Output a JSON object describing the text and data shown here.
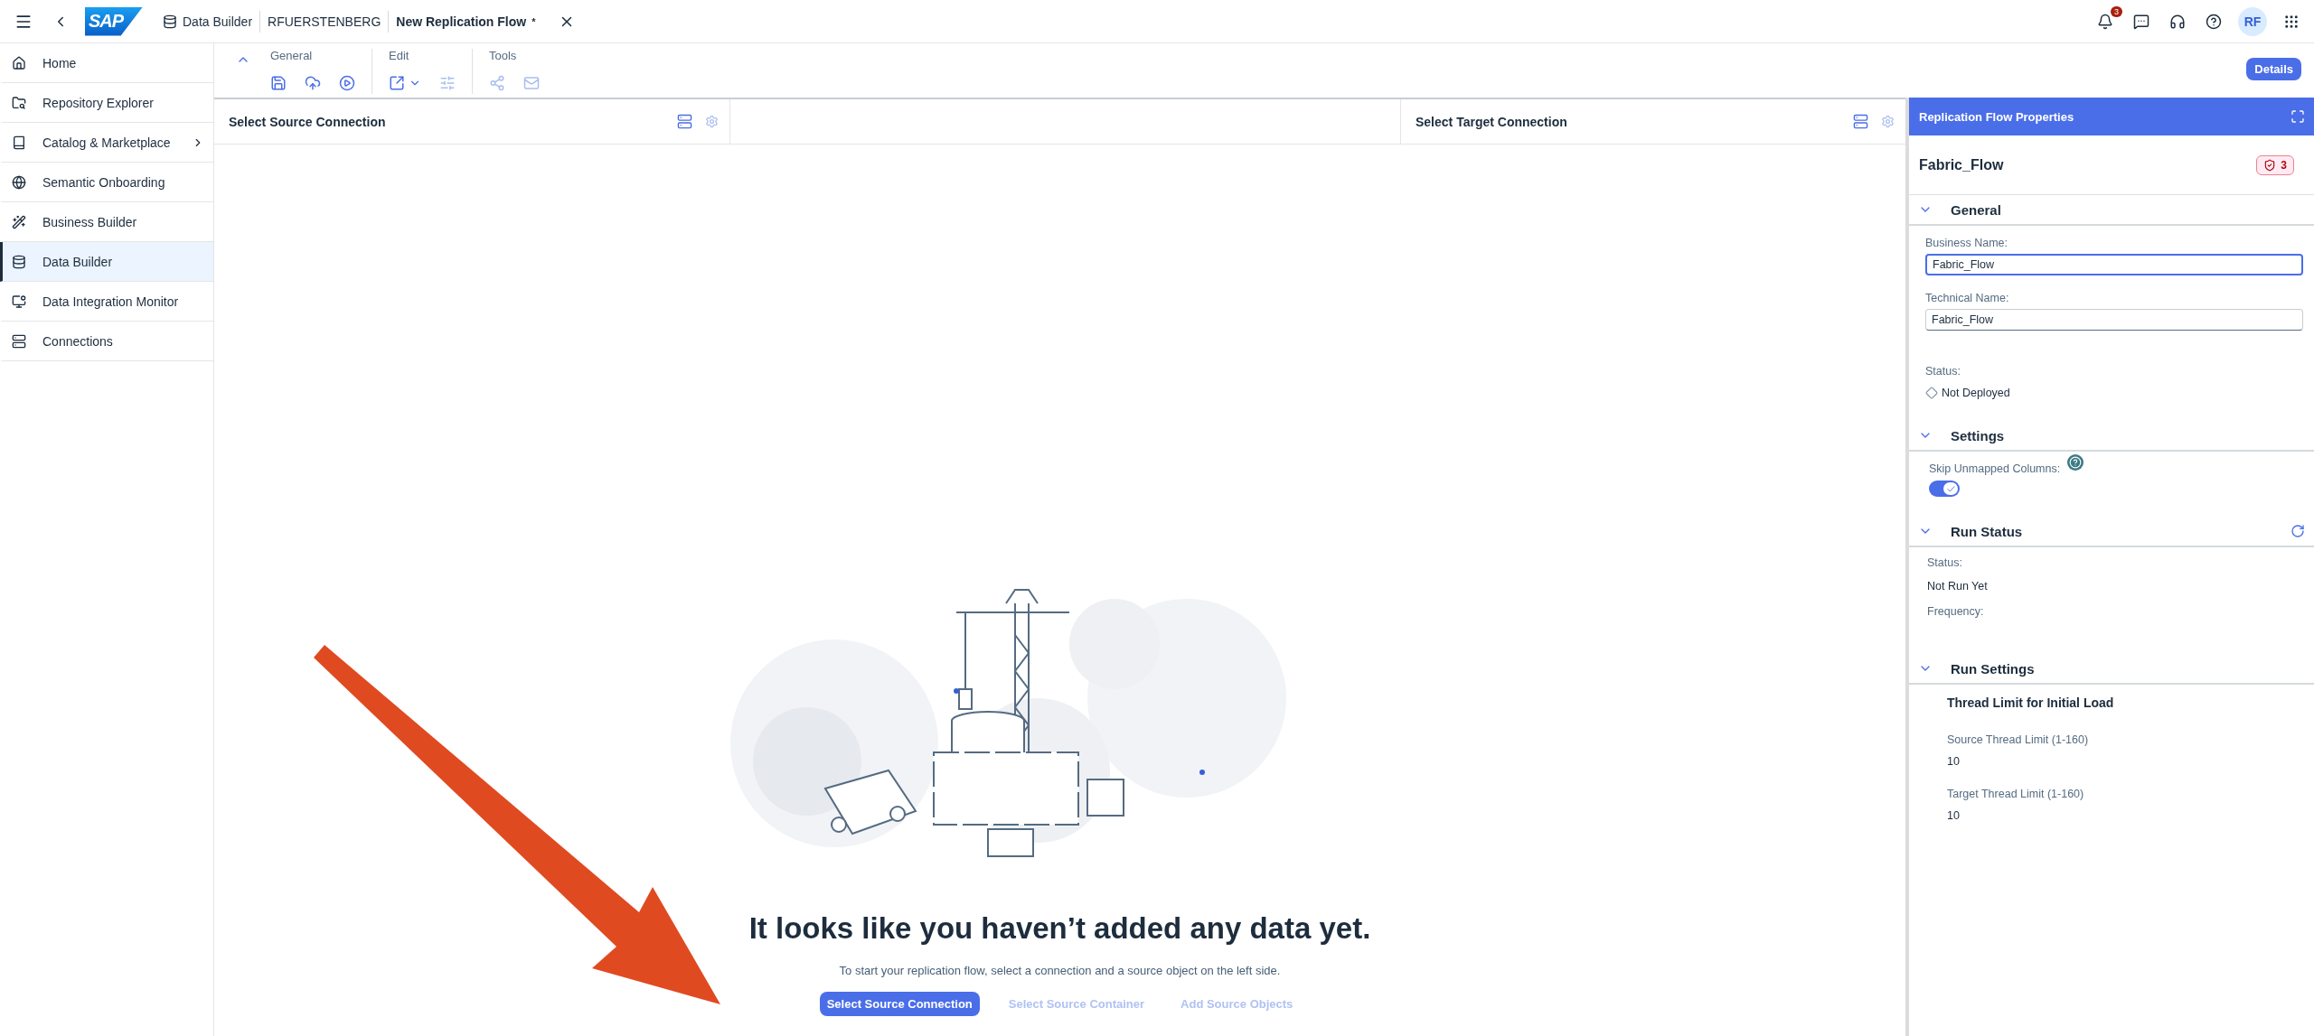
{
  "shellbar": {
    "logo_text": "SAP",
    "breadcrumbs": [
      {
        "label": "Data Builder",
        "current": false
      },
      {
        "label": "RFUERSTENBERG",
        "current": false
      },
      {
        "label": "New Replication Flow",
        "current": true
      }
    ],
    "dirty_mark": "*",
    "notification_count": "3",
    "avatar_initials": "RF"
  },
  "sidebar": {
    "items": [
      {
        "label": "Home",
        "kind": "home",
        "selected": false,
        "expandable": false
      },
      {
        "label": "Repository Explorer",
        "kind": "repository",
        "selected": false,
        "expandable": false
      },
      {
        "label": "Catalog & Marketplace",
        "kind": "catalog",
        "selected": false,
        "expandable": true
      },
      {
        "label": "Semantic Onboarding",
        "kind": "semantic",
        "selected": false,
        "expandable": false
      },
      {
        "label": "Business Builder",
        "kind": "business",
        "selected": false,
        "expandable": false
      },
      {
        "label": "Data Builder",
        "kind": "data",
        "selected": true,
        "expandable": false
      },
      {
        "label": "Data Integration Monitor",
        "kind": "monitor",
        "selected": false,
        "expandable": false
      },
      {
        "label": "Connections",
        "kind": "connections",
        "selected": false,
        "expandable": false
      }
    ]
  },
  "toolbar": {
    "expanded": true,
    "groups": [
      {
        "label": "General",
        "buttons": [
          {
            "kind": "save",
            "disabled": false
          },
          {
            "kind": "deploy",
            "disabled": false
          },
          {
            "kind": "run",
            "disabled": false
          }
        ]
      },
      {
        "label": "Edit",
        "buttons": [
          {
            "kind": "export",
            "disabled": false
          },
          {
            "kind": "mapping",
            "disabled": true
          }
        ]
      },
      {
        "label": "Tools",
        "buttons": [
          {
            "kind": "lineage",
            "disabled": true
          },
          {
            "kind": "mail",
            "disabled": true
          }
        ]
      }
    ],
    "details_button": "Details"
  },
  "canvas": {
    "source_header": "Select Source Connection",
    "target_header": "Select Target Connection",
    "empty_state": {
      "title": "It looks like you haven’t added any data yet.",
      "text": "To start your replication flow, select a connection and a source object on the left side.",
      "steps": [
        {
          "label": "Select Source Connection",
          "enabled": true
        },
        {
          "label": "Select Source Container",
          "enabled": false
        },
        {
          "label": "Add Source Objects",
          "enabled": false
        }
      ]
    }
  },
  "panel": {
    "title": "Replication Flow Properties",
    "object_name": "Fabric_Flow",
    "validation_count": "3",
    "general": {
      "title": "General",
      "expanded": true,
      "business_name_label": "Business Name:",
      "business_name": "Fabric_Flow",
      "technical_name_label": "Technical Name:",
      "technical_name": "Fabric_Flow",
      "status_label": "Status:",
      "status": "Not Deployed"
    },
    "settings": {
      "title": "Settings",
      "expanded": true,
      "skip_label": "Skip Unmapped Columns:",
      "skip_on": true
    },
    "run_status": {
      "title": "Run Status",
      "expanded": true,
      "status_label": "Status:",
      "status": "Not Run Yet",
      "frequency_label": "Frequency:"
    },
    "run_settings": {
      "title": "Run Settings",
      "expanded": true,
      "subtitle": "Thread Limit for Initial Load",
      "source_label": "Source Thread Limit (1-160)",
      "source_value": "10",
      "target_label": "Target Thread Limit (1-160)",
      "target_value": "10"
    }
  }
}
